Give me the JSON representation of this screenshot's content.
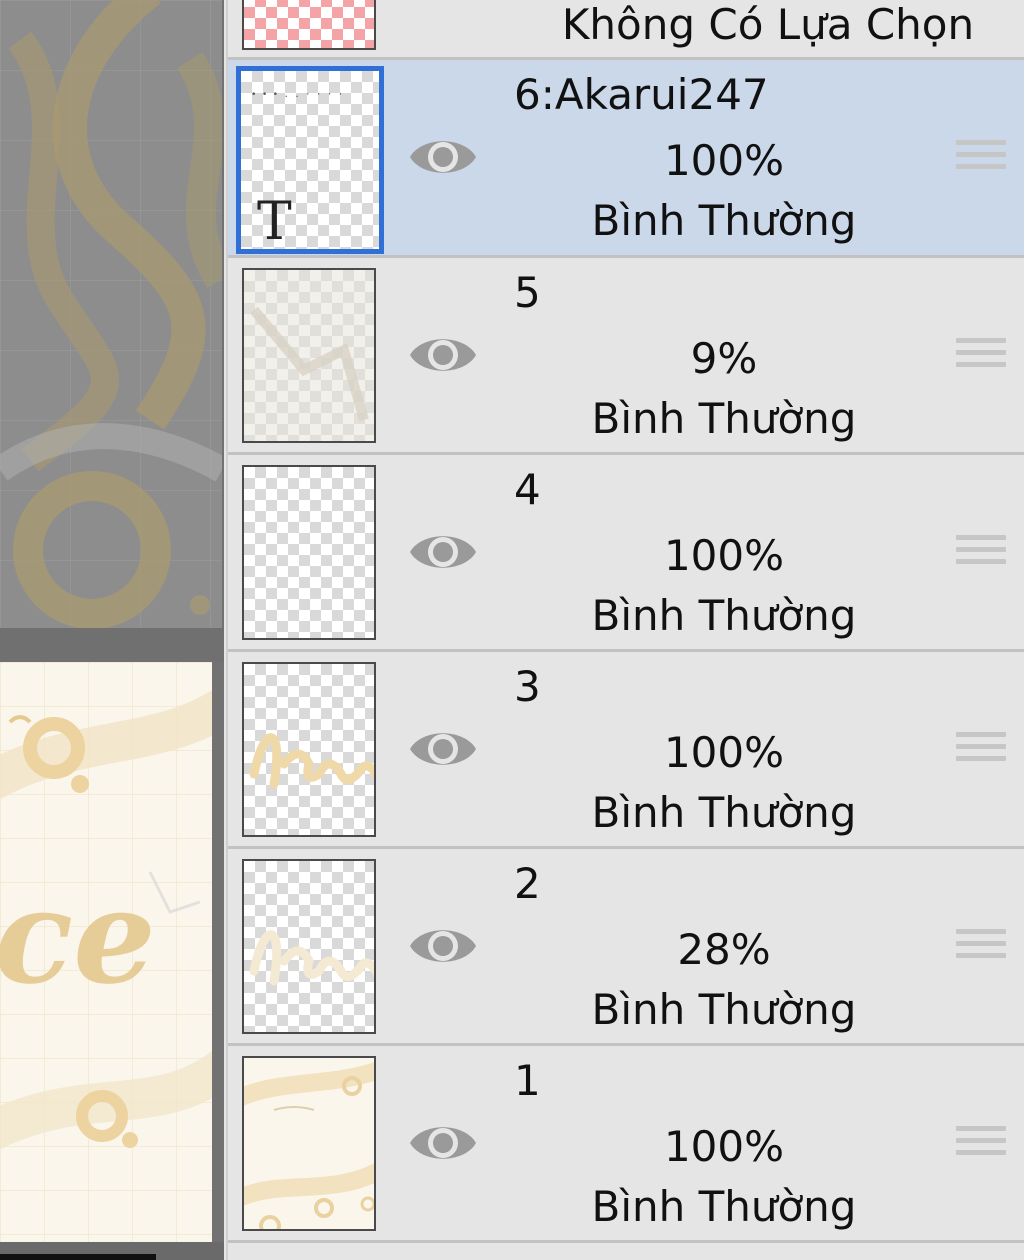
{
  "selection": {
    "label": "Không Có Lựa Chọn"
  },
  "layers": [
    {
      "name": "6:Akarui247",
      "opacity": "100%",
      "blend": "Bình Thường",
      "selected": true,
      "thumb_type": "text",
      "thumb_glyph": "T"
    },
    {
      "name": "5",
      "opacity": "9%",
      "blend": "Bình Thường",
      "selected": false,
      "thumb_type": "faint"
    },
    {
      "name": "4",
      "opacity": "100%",
      "blend": "Bình Thường",
      "selected": false,
      "thumb_type": "empty"
    },
    {
      "name": "3",
      "opacity": "100%",
      "blend": "Bình Thường",
      "selected": false,
      "thumb_type": "lettering"
    },
    {
      "name": "2",
      "opacity": "28%",
      "blend": "Bình Thường",
      "selected": false,
      "thumb_type": "lettering-faint"
    },
    {
      "name": "1",
      "opacity": "100%",
      "blend": "Bình Thường",
      "selected": false,
      "thumb_type": "artwork"
    }
  ],
  "colors": {
    "selected_row": "#cbd8ea",
    "selected_border": "#2f6fd6",
    "panel_bg": "#e5e5e5",
    "eye": "#9a9a9a"
  },
  "icons": {
    "visibility": "eye-icon",
    "reorder": "drag-handle-icon"
  }
}
